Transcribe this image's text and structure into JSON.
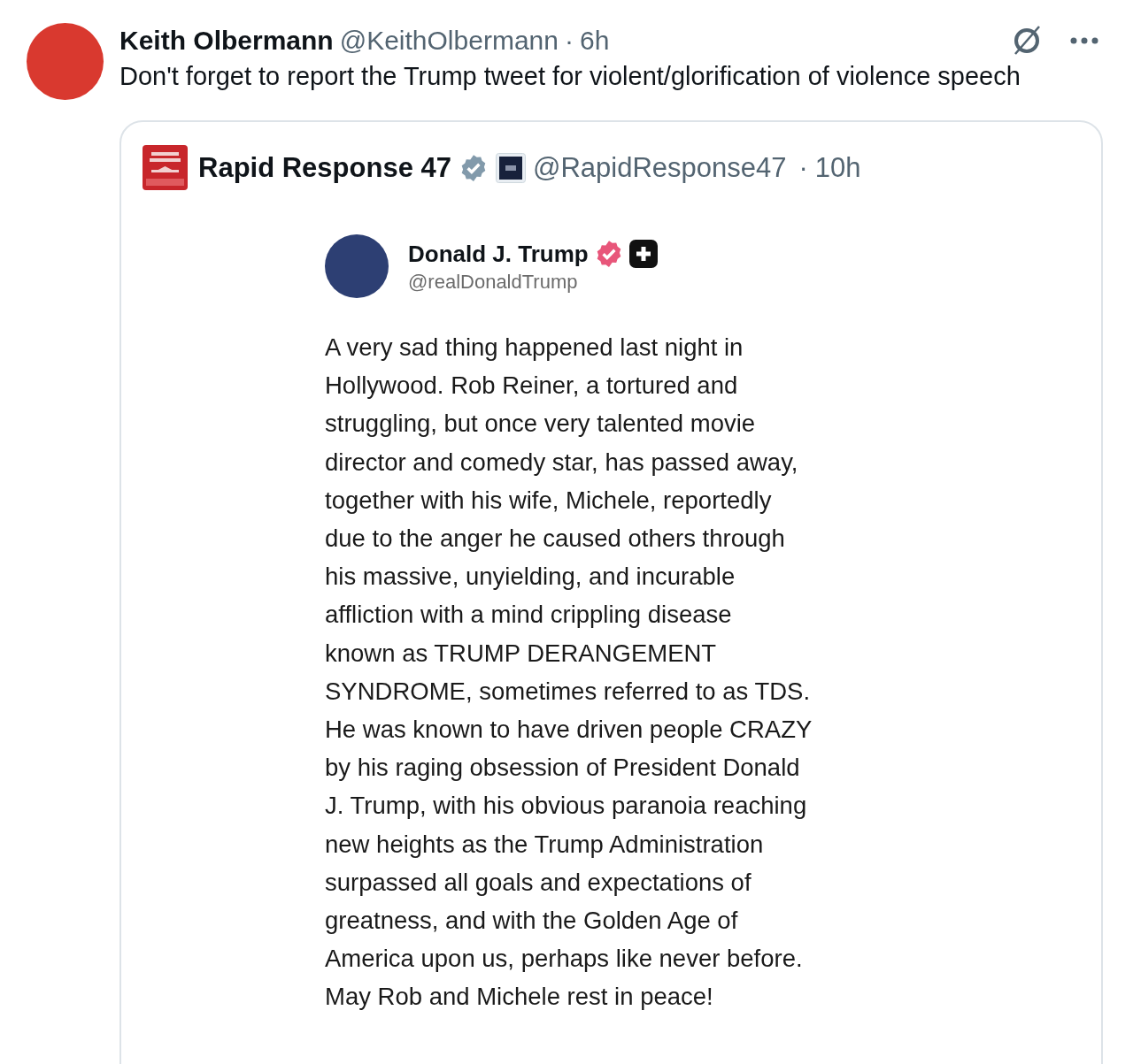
{
  "tweet": {
    "name": "Keith Olbermann",
    "handle": "@KeithOlbermann",
    "separator": "·",
    "time": "6h",
    "text": "Don't forget to report the Trump tweet for violent/glorification of violence speech"
  },
  "quoted": {
    "name": "Rapid Response 47",
    "verified": true,
    "handle": "@RapidResponse47",
    "separator": "·",
    "time": "10h",
    "image": {
      "name": "Donald J. Trump",
      "verified": true,
      "handle": "@realDonaldTrump",
      "text": "A very sad thing happened last night in\nHollywood. Rob Reiner, a tortured and\nstruggling, but once very talented movie\ndirector and comedy star, has passed away,\ntogether with his wife, Michele, reportedly\ndue to the anger he caused others through\nhis massive, unyielding, and incurable\naffliction with a mind crippling disease\nknown as TRUMP DERANGEMENT\nSYNDROME, sometimes referred to as TDS.\nHe was known to have driven people CRAZY\nby his raging obsession of President Donald\nJ. Trump, with his obvious paranoia reaching\nnew heights as the Trump Administration\nsurpassed all goals and expectations of\ngreatness, and with the Golden Age of\nAmerica upon us, perhaps like never before.\nMay Rob and Michele rest in peace!"
    }
  }
}
